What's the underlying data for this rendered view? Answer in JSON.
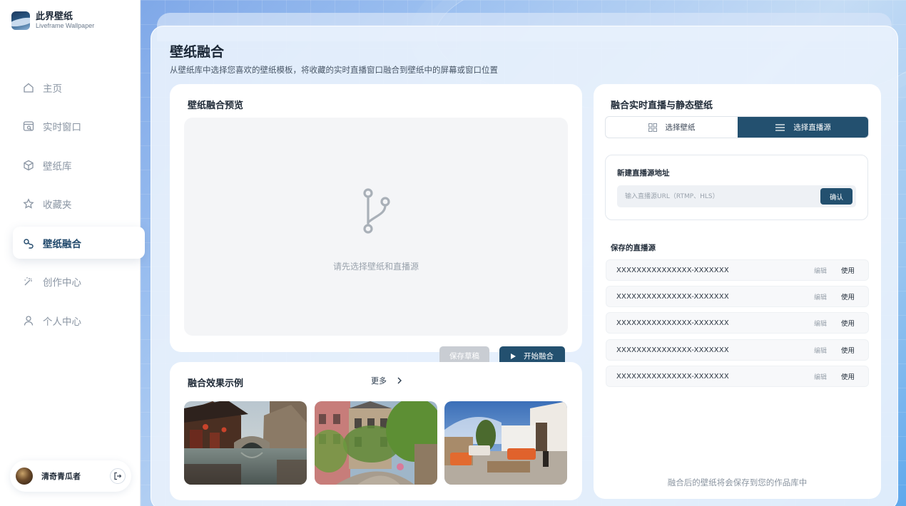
{
  "brand": {
    "name": "此界壁纸",
    "subtitle": "Liveframe Wallpaper"
  },
  "sidebar": {
    "items": [
      {
        "label": "主页",
        "icon": "home-icon"
      },
      {
        "label": "实时窗口",
        "icon": "live-window-icon"
      },
      {
        "label": "壁纸库",
        "icon": "library-box-icon"
      },
      {
        "label": "收藏夹",
        "icon": "star-icon"
      },
      {
        "label": "壁纸融合",
        "icon": "link-icon",
        "active": true
      },
      {
        "label": "创作中心",
        "icon": "magic-wand-icon"
      },
      {
        "label": "个人中心",
        "icon": "user-icon"
      }
    ]
  },
  "user": {
    "name": "清奇青瓜者",
    "logout_icon": "logout-icon"
  },
  "page": {
    "title": "壁纸融合",
    "description": "从壁纸库中选择您喜欢的壁纸模板，将收藏的实时直播窗口融合到壁纸中的屏幕或窗口位置"
  },
  "preview": {
    "title": "壁纸融合预览",
    "hint": "请先选择壁纸和直播源",
    "icon": "branch-icon",
    "save_draft_label": "保存草稿",
    "start_label": "开始融合"
  },
  "examples": {
    "title": "融合效果示例",
    "more_label": "更多",
    "thumbnails": [
      "canal-town-photo",
      "ivy-street-photo",
      "rooftop-terrace-photo"
    ]
  },
  "fusion": {
    "title": "融合实时直播与静态壁纸",
    "tabs": [
      {
        "label": "选择壁纸",
        "icon": "grid-icon",
        "active": false
      },
      {
        "label": "选择直播源",
        "icon": "menu-icon",
        "active": true
      }
    ],
    "new_source": {
      "title": "新建直播源地址",
      "placeholder": "输入直播源URL（RTMP、HLS）",
      "value": "",
      "confirm_label": "确认"
    },
    "saved": {
      "title": "保存的直播源",
      "edit_label": "编辑",
      "use_label": "使用",
      "items": [
        "XXXXXXXXXXXXXXX-XXXXXXX",
        "XXXXXXXXXXXXXXX-XXXXXXX",
        "XXXXXXXXXXXXXXX-XXXXXXX",
        "XXXXXXXXXXXXXXX-XXXXXXX",
        "XXXXXXXXXXXXXXX-XXXXXXX"
      ]
    },
    "footnote": "融合后的壁纸将会保存到您的作品库中"
  },
  "colors": {
    "primary": "#23506F",
    "disabled": "#C9CDD3",
    "sidebar_active": "#20486B"
  }
}
